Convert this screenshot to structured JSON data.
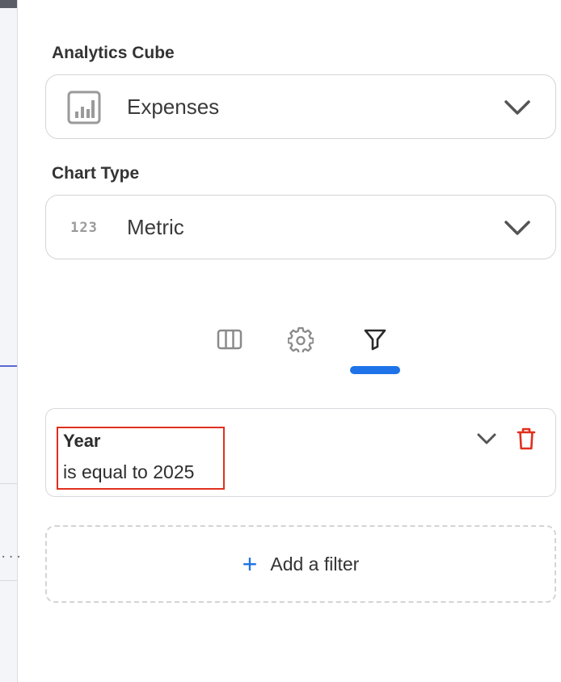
{
  "panel": {
    "cube": {
      "label": "Analytics Cube",
      "value": "Expenses",
      "icon": "cube-chart-icon"
    },
    "chart_type": {
      "label": "Chart Type",
      "value": "Metric",
      "icon_text": "123"
    },
    "tabs": [
      {
        "name": "columns-icon",
        "active": false
      },
      {
        "name": "gear-icon",
        "active": false
      },
      {
        "name": "filter-icon",
        "active": true
      }
    ],
    "filter": {
      "field": "Year",
      "condition": "is equal to 2025"
    },
    "add_filter": {
      "plus": "+",
      "label": "Add a filter"
    }
  },
  "colors": {
    "accent": "#1e73e8",
    "danger": "#e0301e",
    "border": "#d4d4d8"
  }
}
